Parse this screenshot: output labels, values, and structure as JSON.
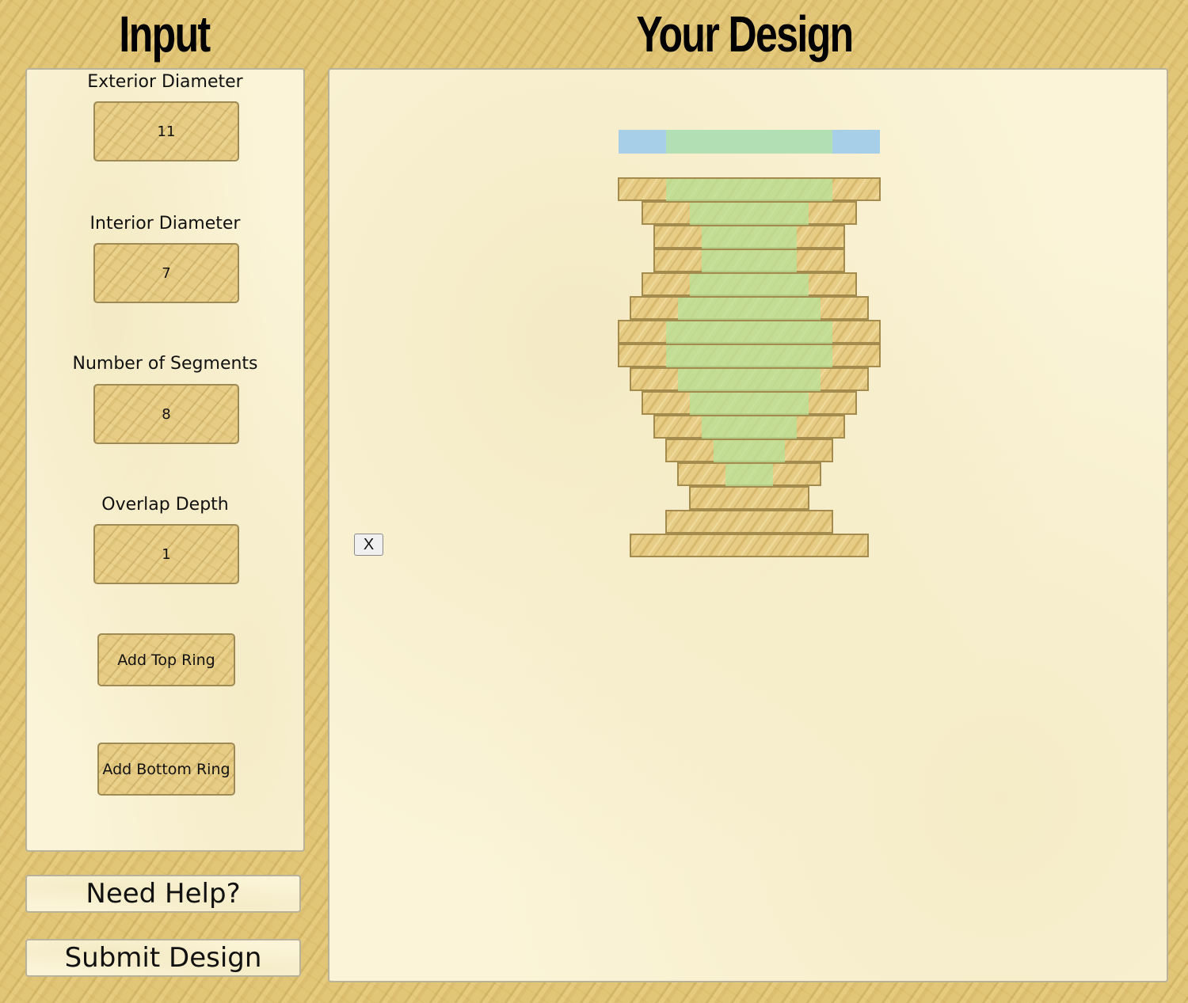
{
  "headings": {
    "input": "Input",
    "design": "Your Design"
  },
  "inputs": {
    "exterior_diameter": {
      "label": "Exterior Diameter",
      "value": "11"
    },
    "interior_diameter": {
      "label": "Interior Diameter",
      "value": "7"
    },
    "number_of_segments": {
      "label": "Number of Segments",
      "value": "8"
    },
    "overlap_depth": {
      "label": "Overlap Depth",
      "value": "1"
    }
  },
  "buttons": {
    "add_top_ring": "Add Top Ring",
    "add_bottom_ring": "Add Bottom Ring",
    "need_help": "Need Help?",
    "submit_design": "Submit Design",
    "delete": "X"
  },
  "colors": {
    "preview_exterior": "#a8cfe8",
    "preview_interior": "#b2e0b4",
    "interior_overlay": "#b8e39a",
    "ring_border": "#a38b4d",
    "ring_wood": "#e6cc85"
  },
  "design": {
    "preview_ring": {
      "exterior": 11,
      "interior": 7
    },
    "rings": [
      {
        "exterior": 11,
        "interior": 7
      },
      {
        "exterior": 9,
        "interior": 5
      },
      {
        "exterior": 8,
        "interior": 4
      },
      {
        "exterior": 8,
        "interior": 4
      },
      {
        "exterior": 9,
        "interior": 5
      },
      {
        "exterior": 10,
        "interior": 6
      },
      {
        "exterior": 11,
        "interior": 7
      },
      {
        "exterior": 11,
        "interior": 7
      },
      {
        "exterior": 10,
        "interior": 6
      },
      {
        "exterior": 9,
        "interior": 5
      },
      {
        "exterior": 8,
        "interior": 4
      },
      {
        "exterior": 7,
        "interior": 3
      },
      {
        "exterior": 6,
        "interior": 2
      },
      {
        "exterior": 5,
        "interior": 0
      },
      {
        "exterior": 7,
        "interior": 0
      },
      {
        "exterior": 10,
        "interior": 0
      }
    ]
  }
}
